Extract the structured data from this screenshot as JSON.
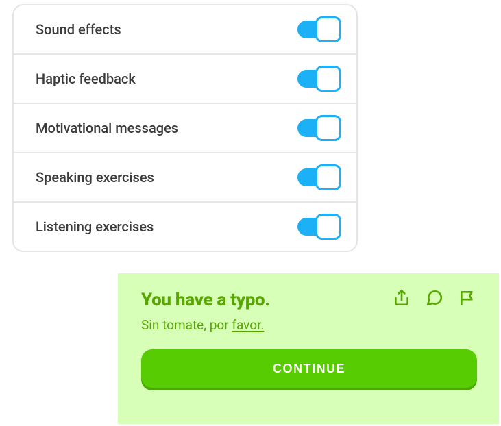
{
  "settings": {
    "items": [
      {
        "label": "Sound effects",
        "value": true
      },
      {
        "label": "Haptic feedback",
        "value": true
      },
      {
        "label": "Motivational messages",
        "value": true
      },
      {
        "label": "Speaking exercises",
        "value": true
      },
      {
        "label": "Listening exercises",
        "value": true
      }
    ]
  },
  "feedback": {
    "heading": "You have a typo.",
    "sentence_prefix": "Sin tomate, por ",
    "typo_word": "favor.",
    "continue_label": "CONTINUE"
  },
  "colors": {
    "toggle_active": "#1cb0f6",
    "banner_bg": "#d7ffb8",
    "accent_green_dark": "#58a700",
    "button_green": "#58cc02",
    "button_shadow": "#4aa902"
  }
}
